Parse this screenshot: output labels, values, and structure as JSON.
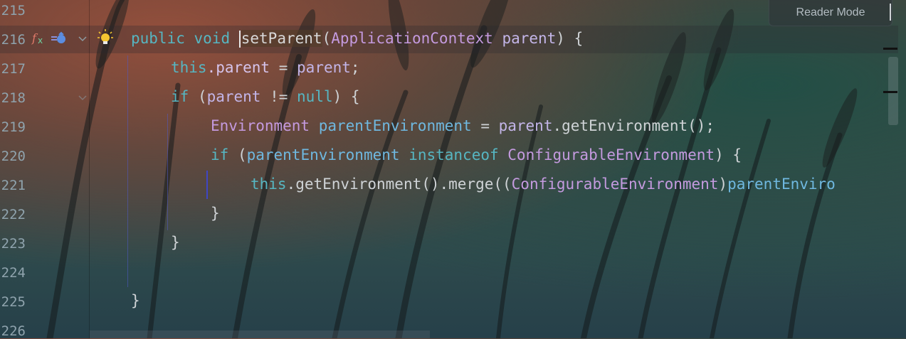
{
  "editor": {
    "line_numbers": [
      "215",
      "216",
      "217",
      "218",
      "219",
      "220",
      "221",
      "222",
      "223",
      "224",
      "225",
      "226"
    ],
    "code": {
      "l216": {
        "kw_public": "public",
        "kw_void": "void",
        "method": "setParent",
        "open_paren": "(",
        "type": "ApplicationContext",
        "param": "parent",
        "close": ") {"
      },
      "l217": {
        "kw_this": "this",
        "field": ".parent",
        "op": " = ",
        "var": "parent",
        "end": ";"
      },
      "l218": {
        "kw_if": "if",
        "open": " (",
        "var": "parent",
        "op": " != ",
        "kw_null": "null",
        "close": ") {"
      },
      "l219": {
        "type": "Environment",
        "var": "parentEnvironment",
        "op": " = ",
        "obj": "parent",
        "call": ".getEnvironment();"
      },
      "l220": {
        "kw_if": "if",
        "open": " (",
        "var": "parentEnvironment",
        "kw_instanceof": "instanceof",
        "type": "ConfigurableEnvironment",
        "close": ") {"
      },
      "l221": {
        "kw_this": "this",
        "call": ".getEnvironment().merge((",
        "type": "ConfigurableEnvironment",
        "close": ")",
        "var": "parentEnviro"
      },
      "l222": {
        "brace": "}"
      },
      "l223": {
        "brace": "}"
      },
      "l225": {
        "brace": "}"
      }
    }
  },
  "reader_mode": {
    "label": "Reader Mode"
  },
  "icons": {
    "method_icon": "function-icon",
    "override_icon": "implement-method-icon",
    "fold_icon": "fold-chevron-icon",
    "intention_icon": "lightbulb-icon"
  },
  "colors": {
    "keyword": "#56b6c2",
    "type": "#c49adf",
    "line_number": "#8fa3ad"
  }
}
